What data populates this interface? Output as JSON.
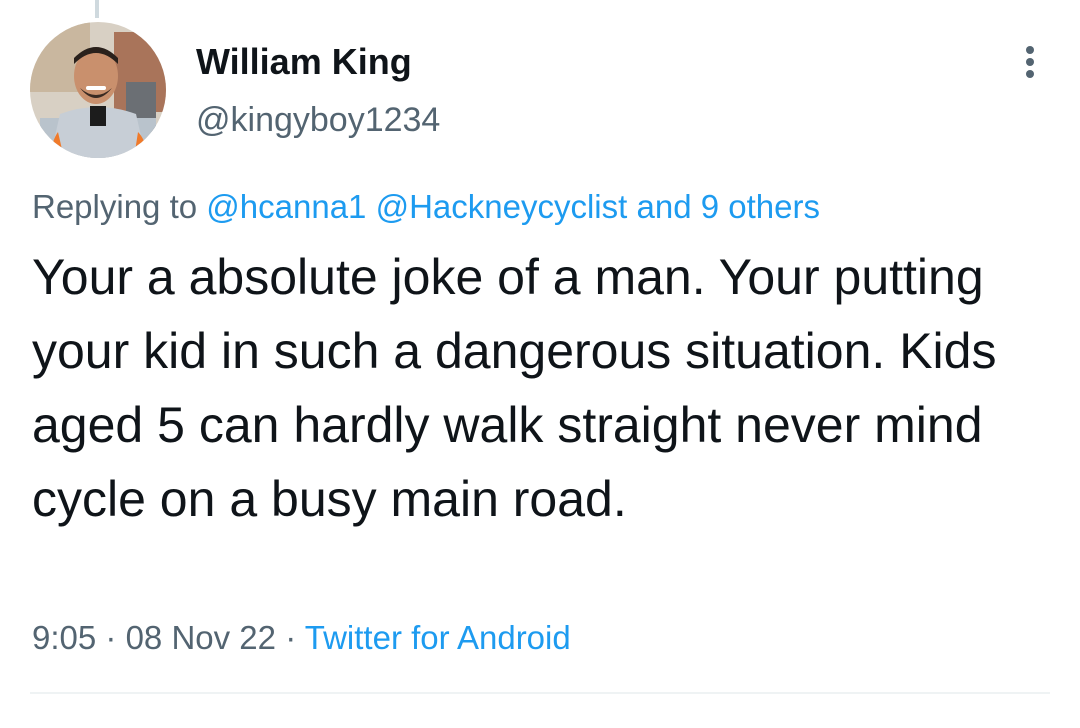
{
  "tweet": {
    "author": {
      "display_name": "William King",
      "handle": "@kingyboy1234",
      "avatar": "profile-photo"
    },
    "more_icon": "more-vertical-icon",
    "reply_context": {
      "prefix": "Replying to",
      "mentions": [
        "@hcanna1",
        "@Hackneycyclist"
      ],
      "others": "and 9 others"
    },
    "text": "Your a absolute joke of a man. Your putting your kid in such a dangerous situation. Kids aged 5 can hardly walk straight never mind cycle on a busy main road.",
    "meta": {
      "time": "9:05",
      "separator": "·",
      "date": "08 Nov 22",
      "source": "Twitter for Android"
    }
  },
  "colors": {
    "link": "#1d9bf0",
    "secondary_text": "#536471",
    "primary_text": "#0f1419",
    "divider": "#eff3f4"
  }
}
